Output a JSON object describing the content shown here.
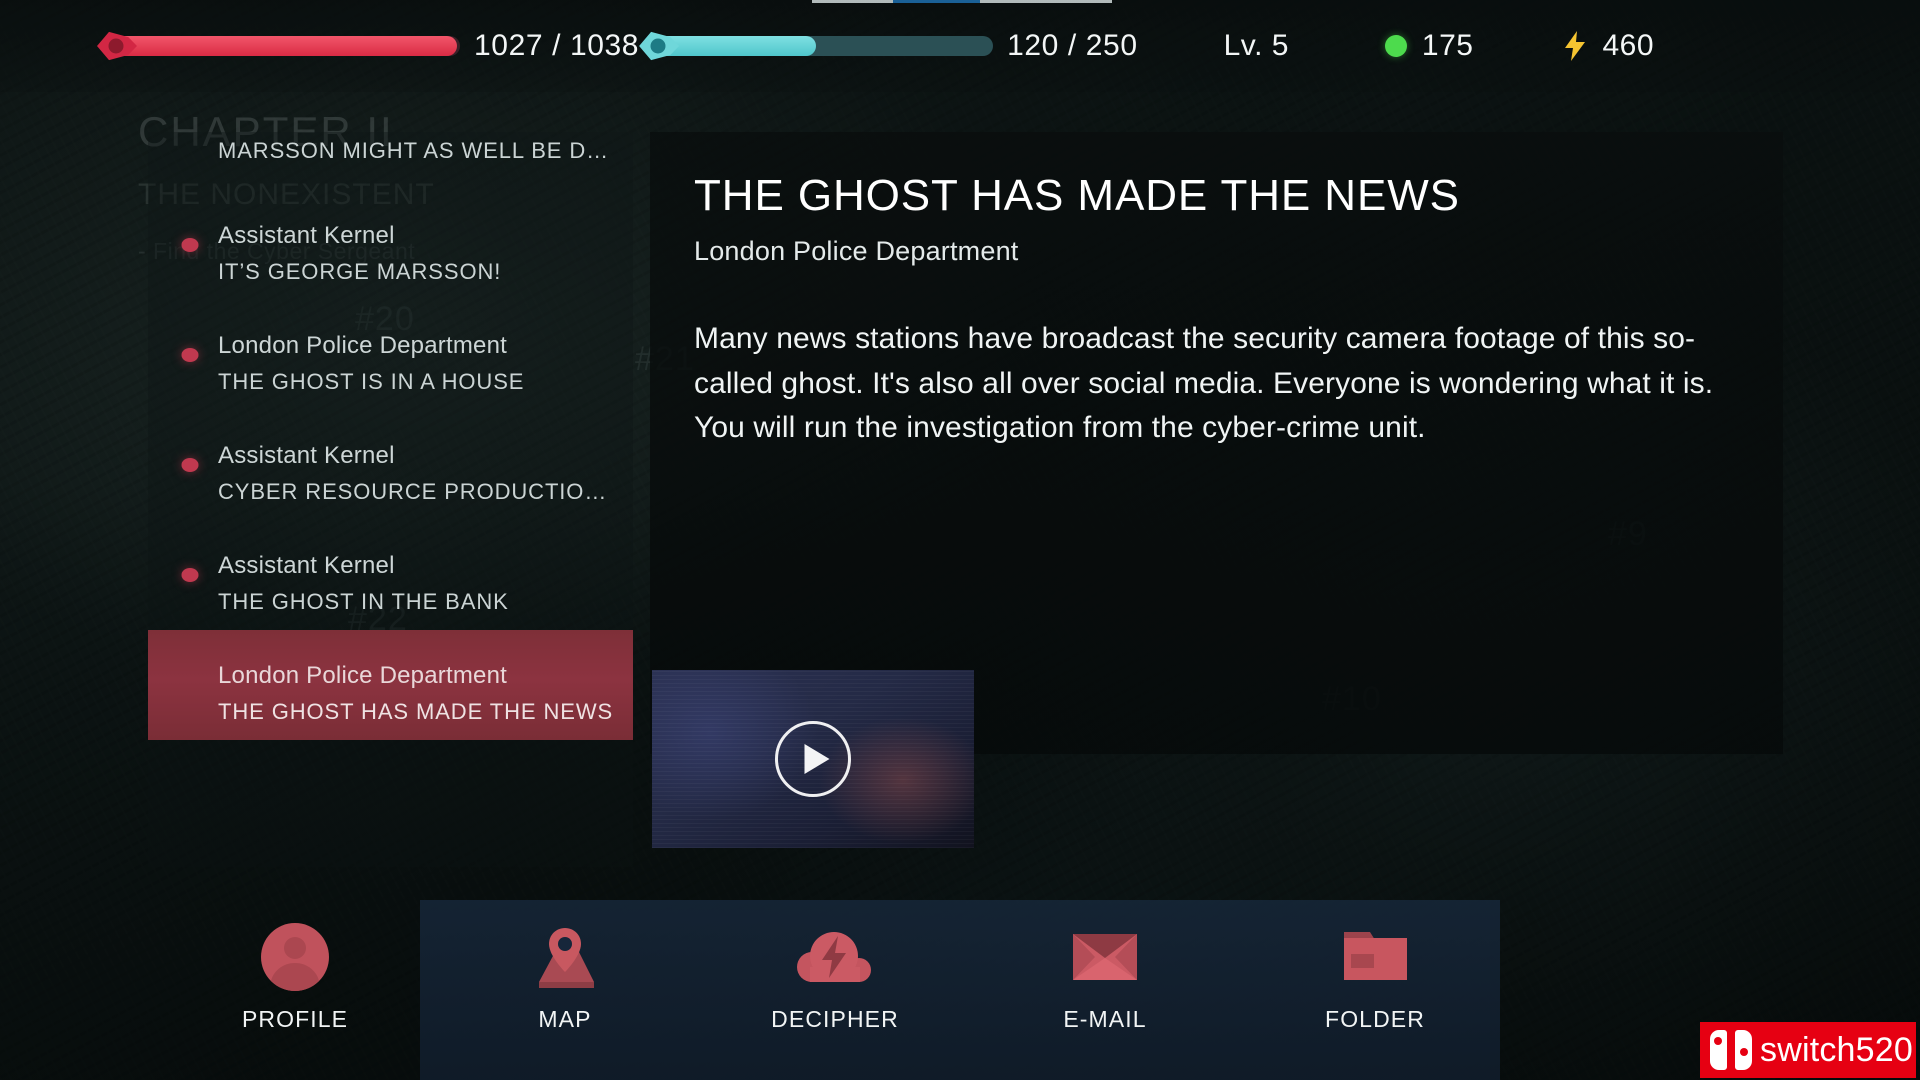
{
  "status_bar": {
    "health": {
      "label": "health-bar",
      "current": 1027,
      "max": 1038,
      "display": "1027 / 1038",
      "percent": 99,
      "color": "#e8354f"
    },
    "energy": {
      "label": "energy-bar",
      "current": 120,
      "max": 250,
      "display": "120 / 250",
      "percent": 48,
      "color": "#5fd2d6"
    },
    "level": "Lv. 5",
    "resource_green": {
      "icon": "green-dot-icon",
      "value": "175",
      "color": "#4ddb4d"
    },
    "resource_energy": {
      "icon": "lightning-bolt-icon",
      "value": "460",
      "color": "#f5c431"
    }
  },
  "background_watermark": {
    "chapter": "CHAPTER II",
    "chapter_subtitle": "THE NONEXISTENT",
    "objective": "- Find the Cyber Sergeant",
    "numbers": [
      "#20",
      "#21",
      "#22",
      "#9",
      "#10"
    ]
  },
  "message_list": {
    "items": [
      {
        "sender": "",
        "subject": "MARSSON MIGHT AS WELL BE DE…",
        "unread": false,
        "selected": false,
        "partial": true
      },
      {
        "sender": "Assistant Kernel",
        "subject": "IT’S GEORGE MARSSON!",
        "unread": true,
        "selected": false,
        "partial": false
      },
      {
        "sender": "London Police Department",
        "subject": "THE GHOST IS IN A HOUSE",
        "unread": true,
        "selected": false,
        "partial": false
      },
      {
        "sender": "Assistant Kernel",
        "subject": "CYBER RESOURCE PRODUCTION …",
        "unread": true,
        "selected": false,
        "partial": false
      },
      {
        "sender": "Assistant Kernel",
        "subject": "THE GHOST IN THE BANK",
        "unread": true,
        "selected": false,
        "partial": false
      },
      {
        "sender": "London Police Department",
        "subject": "THE GHOST HAS MADE THE NEWS",
        "unread": false,
        "selected": true,
        "partial": false
      }
    ]
  },
  "content": {
    "title": "THE GHOST HAS MADE THE NEWS",
    "sender": "London Police Department",
    "body": "Many news stations have broadcast the security camera footage of this so-called ghost. It's also all over social media. Everyone is wondering what it is. You will run the investigation from the cyber-crime unit.",
    "attachment": {
      "type": "video",
      "play_icon": "play-circle-icon"
    }
  },
  "nav_bar": {
    "items": [
      {
        "label": "PROFILE",
        "icon": "user-avatar-icon"
      },
      {
        "label": "MAP",
        "icon": "map-pin-icon"
      },
      {
        "label": "DECIPHER",
        "icon": "cloud-bolt-icon"
      },
      {
        "label": "E-MAIL",
        "icon": "envelope-icon"
      },
      {
        "label": "FOLDER",
        "icon": "folder-icon"
      }
    ],
    "accent_color": "#c0525c",
    "panel_color": "#16263a"
  },
  "watermark": {
    "text": "switch520",
    "brand_color": "#e60012"
  }
}
